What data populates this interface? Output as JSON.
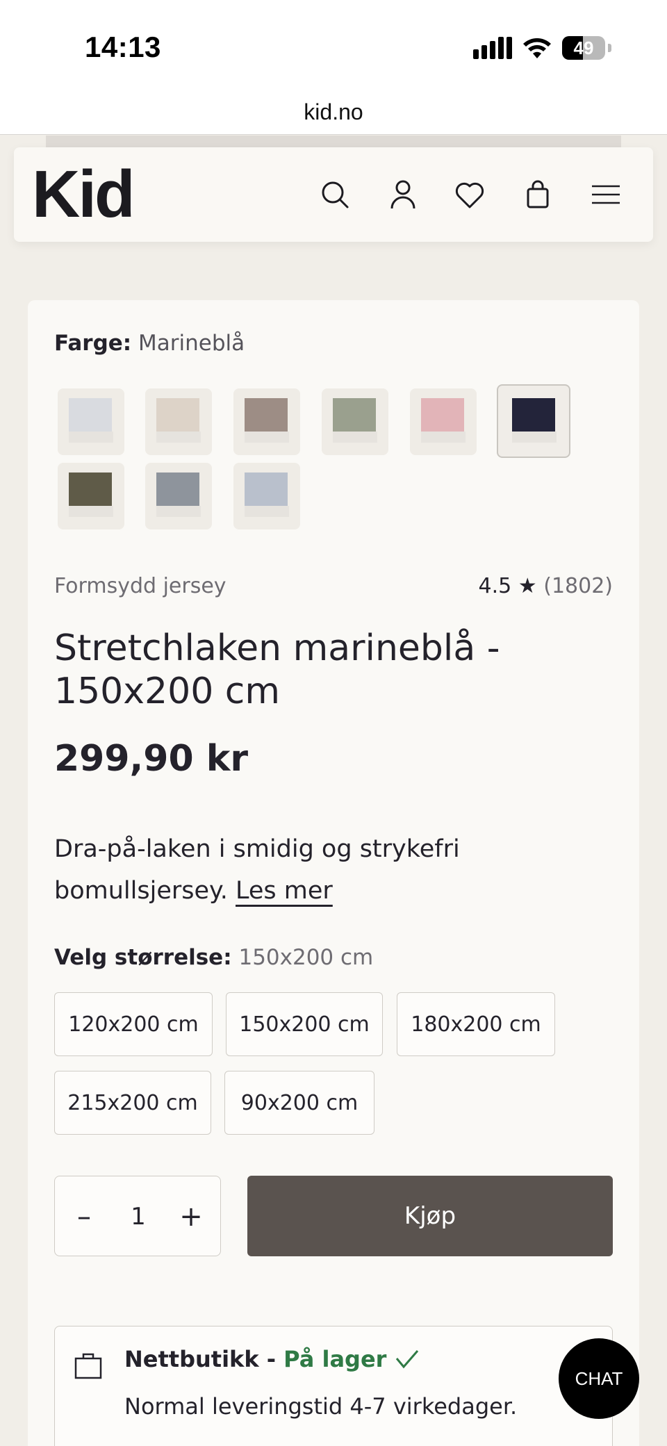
{
  "status_bar": {
    "time": "14:13",
    "battery": "49",
    "battery_level": 0.49
  },
  "browser": {
    "url": "kid.no"
  },
  "header": {
    "logo": "Kid",
    "icons": [
      "search-icon",
      "account-icon",
      "heart-icon",
      "bag-icon",
      "menu-icon"
    ]
  },
  "product": {
    "color_label": "Farge:",
    "color_value": "Marineblå",
    "swatches": [
      {
        "color": "#d9dbe0",
        "selected": false
      },
      {
        "color": "#ddd3c8",
        "selected": false
      },
      {
        "color": "#9d8d85",
        "selected": false
      },
      {
        "color": "#9aa08e",
        "selected": false
      },
      {
        "color": "#e2b4b8",
        "selected": false
      },
      {
        "color": "#23243a",
        "selected": true
      },
      {
        "color": "#5f5b48",
        "selected": false
      },
      {
        "color": "#8e949c",
        "selected": false
      },
      {
        "color": "#b9c0cc",
        "selected": false
      }
    ],
    "category": "Formsydd jersey",
    "rating": "4.5",
    "rating_count": "(1802)",
    "title": "Stretchlaken marineblå - 150x200 cm",
    "price": "299,90 kr",
    "description": "Dra-på-laken i smidig og strykefri bomullsjersey.",
    "read_more": "Les mer",
    "size_label": "Velg størrelse:",
    "size_value": "150x200 cm",
    "sizes": [
      {
        "label": "120x200 cm",
        "selected": false
      },
      {
        "label": "150x200 cm",
        "selected": true
      },
      {
        "label": "180x200 cm",
        "selected": false
      },
      {
        "label": "215x200 cm",
        "selected": false
      },
      {
        "label": "90x200 cm",
        "selected": false
      }
    ],
    "quantity": "1",
    "buy_label": "Kjøp"
  },
  "stock": {
    "store": "Nettbutikk -",
    "status": "På lager",
    "delivery": "Normal leveringstid 4-7 virkedager."
  },
  "chat": {
    "label": "CHAT"
  },
  "colors": {
    "accent_button": "#5a534f",
    "in_stock": "#2f7a45",
    "background": "#f1eee8"
  }
}
